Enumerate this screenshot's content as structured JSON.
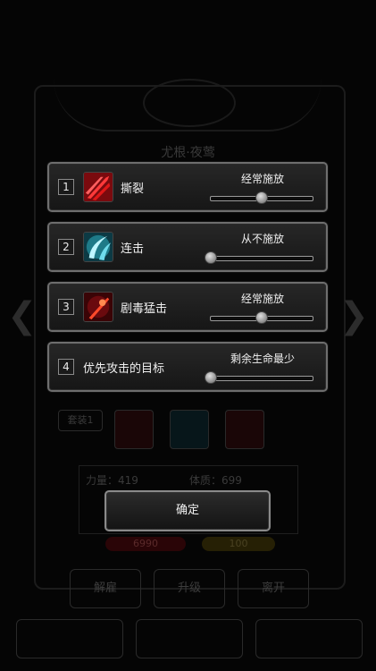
{
  "background": {
    "hero_name": "尤根·夜莺",
    "set_tag": "套装1",
    "stats": [
      "力量：419",
      "体质：699"
    ],
    "hp_value": "6990",
    "energy_value": "100",
    "buttons_row1": [
      "解雇",
      "升级",
      "离开"
    ]
  },
  "skills": [
    {
      "index": "1",
      "name": "撕裂",
      "setting": "经常施放",
      "level": 0.5,
      "icon": "claw-slash-red-icon"
    },
    {
      "index": "2",
      "name": "连击",
      "setting": "从不施放",
      "level": 0.0,
      "icon": "blade-slash-cyan-icon"
    },
    {
      "index": "3",
      "name": "剧毒猛击",
      "setting": "经常施放",
      "level": 0.5,
      "icon": "poison-strike-red-icon"
    }
  ],
  "targeting": {
    "index": "4",
    "name": "优先攻击的目标",
    "setting": "剩余生命最少",
    "level": 0.0
  },
  "confirm_label": "确定",
  "colors": {
    "panel_border": "#6e6e6e",
    "text": "#f0f0f0",
    "skill_red": "#c8141c",
    "skill_cyan": "#4fc7d8"
  }
}
